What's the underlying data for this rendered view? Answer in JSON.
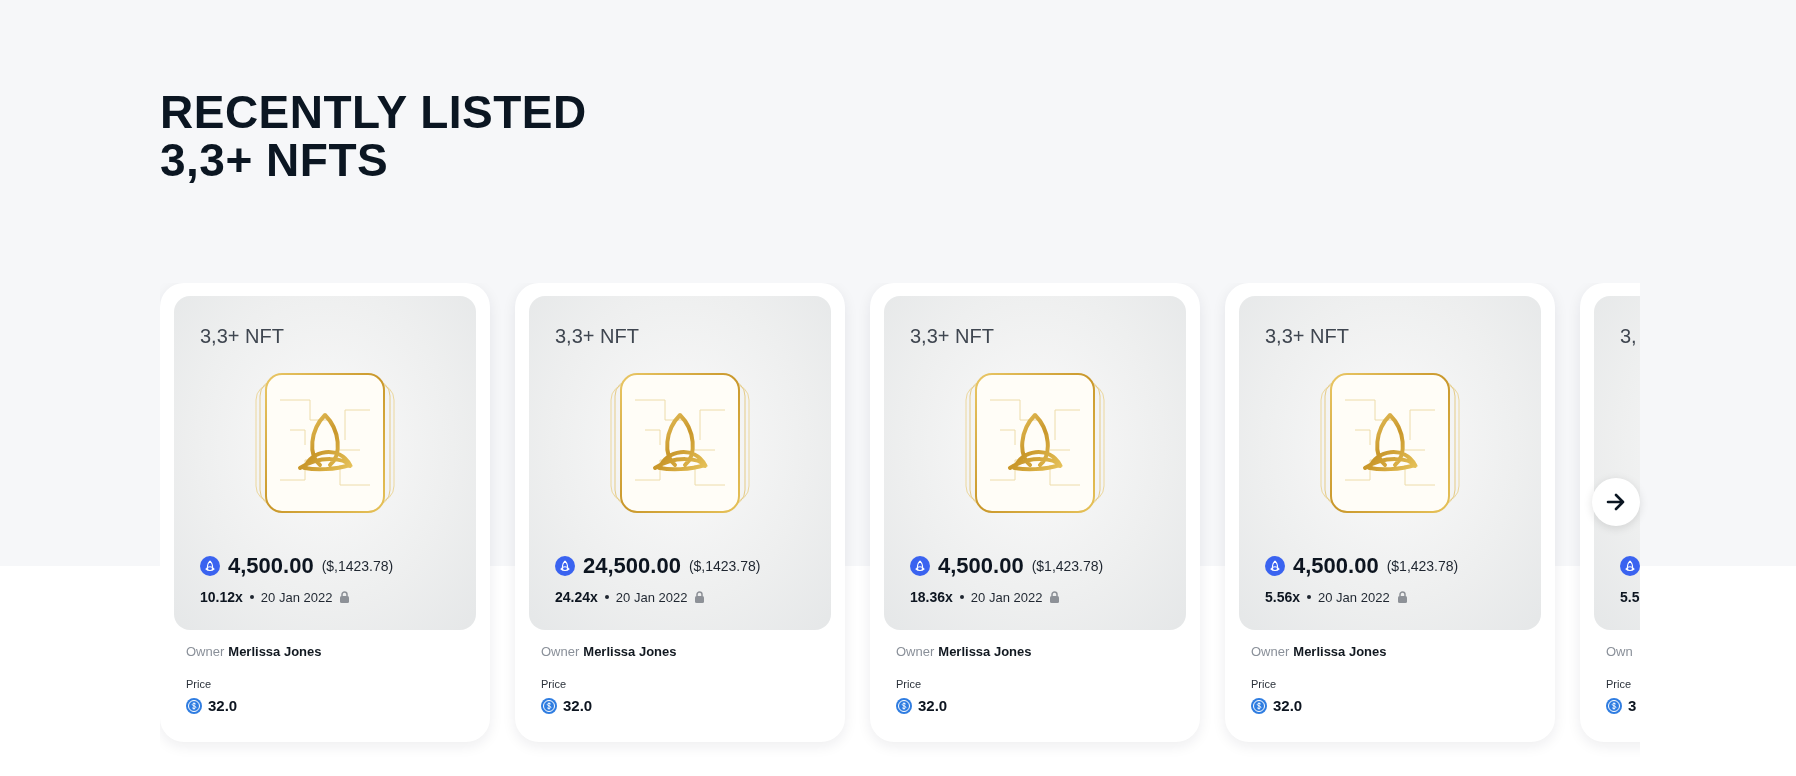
{
  "heading": {
    "lines": [
      "RECENTLY LISTED",
      "3,3+ NFTS"
    ]
  },
  "cards": [
    {
      "title": "3,3+ NFT",
      "amount": "4,500.00",
      "usd": "($,1423.78)",
      "multiplier": "10.12x",
      "date": "20 Jan 2022",
      "owner_label": "Owner",
      "owner": "Merlissa Jones",
      "price_label": "Price",
      "price": "32.0"
    },
    {
      "title": "3,3+ NFT",
      "amount": "24,500.00",
      "usd": "($,1423.78)",
      "multiplier": "24.24x",
      "date": "20 Jan 2022",
      "owner_label": "Owner",
      "owner": "Merlissa Jones",
      "price_label": "Price",
      "price": "32.0"
    },
    {
      "title": "3,3+ NFT",
      "amount": "4,500.00",
      "usd": "($1,423.78)",
      "multiplier": "18.36x",
      "date": "20 Jan 2022",
      "owner_label": "Owner",
      "owner": "Merlissa Jones",
      "price_label": "Price",
      "price": "32.0"
    },
    {
      "title": "3,3+ NFT",
      "amount": "4,500.00",
      "usd": "($1,423.78)",
      "multiplier": "5.56x",
      "date": "20 Jan 2022",
      "owner_label": "Owner",
      "owner": "Merlissa Jones",
      "price_label": "Price",
      "price": "32.0"
    },
    {
      "title": "3,",
      "multiplier": "5.5",
      "owner_label": "Own",
      "price_label": "Price",
      "price": "3"
    }
  ]
}
